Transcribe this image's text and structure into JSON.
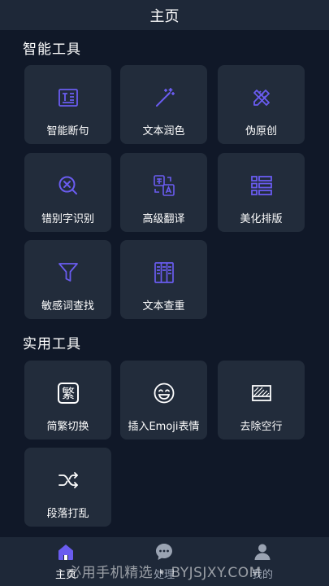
{
  "header": {
    "title": "主页"
  },
  "sections": {
    "smart_tools": {
      "title": "智能工具",
      "items": [
        {
          "label": "智能断句",
          "icon": "text-box-icon"
        },
        {
          "label": "文本润色",
          "icon": "magic-wand-icon"
        },
        {
          "label": "伪原创",
          "icon": "pencil-ruler-icon"
        },
        {
          "label": "错别字识别",
          "icon": "circle-x-search-icon"
        },
        {
          "label": "高级翻译",
          "icon": "translate-icon"
        },
        {
          "label": "美化排版",
          "icon": "list-layout-icon"
        },
        {
          "label": "敏感词查找",
          "icon": "filter-icon"
        },
        {
          "label": "文本查重",
          "icon": "columns-icon"
        }
      ]
    },
    "practical_tools": {
      "title": "实用工具",
      "items": [
        {
          "label": "简繁切换",
          "icon": "traditional-char-icon",
          "glyph": "繁"
        },
        {
          "label": "插入Emoji表情",
          "icon": "laughing-face-icon"
        },
        {
          "label": "去除空行",
          "icon": "empty-box-icon"
        },
        {
          "label": "段落打乱",
          "icon": "shuffle-icon"
        }
      ]
    }
  },
  "tabbar": {
    "tabs": [
      {
        "label": "主页",
        "icon": "home-icon",
        "active": true
      },
      {
        "label": "处理",
        "icon": "chat-bubble-icon",
        "active": false
      },
      {
        "label": "我的",
        "icon": "user-icon",
        "active": false
      }
    ]
  },
  "watermark": "必用手机精选 • BYJSJXY.COM",
  "colors": {
    "background": "#101828",
    "card": "#222c3b",
    "header": "#1e2838",
    "accent": "#6a5cf0",
    "inactive": "#9aa3b2"
  }
}
